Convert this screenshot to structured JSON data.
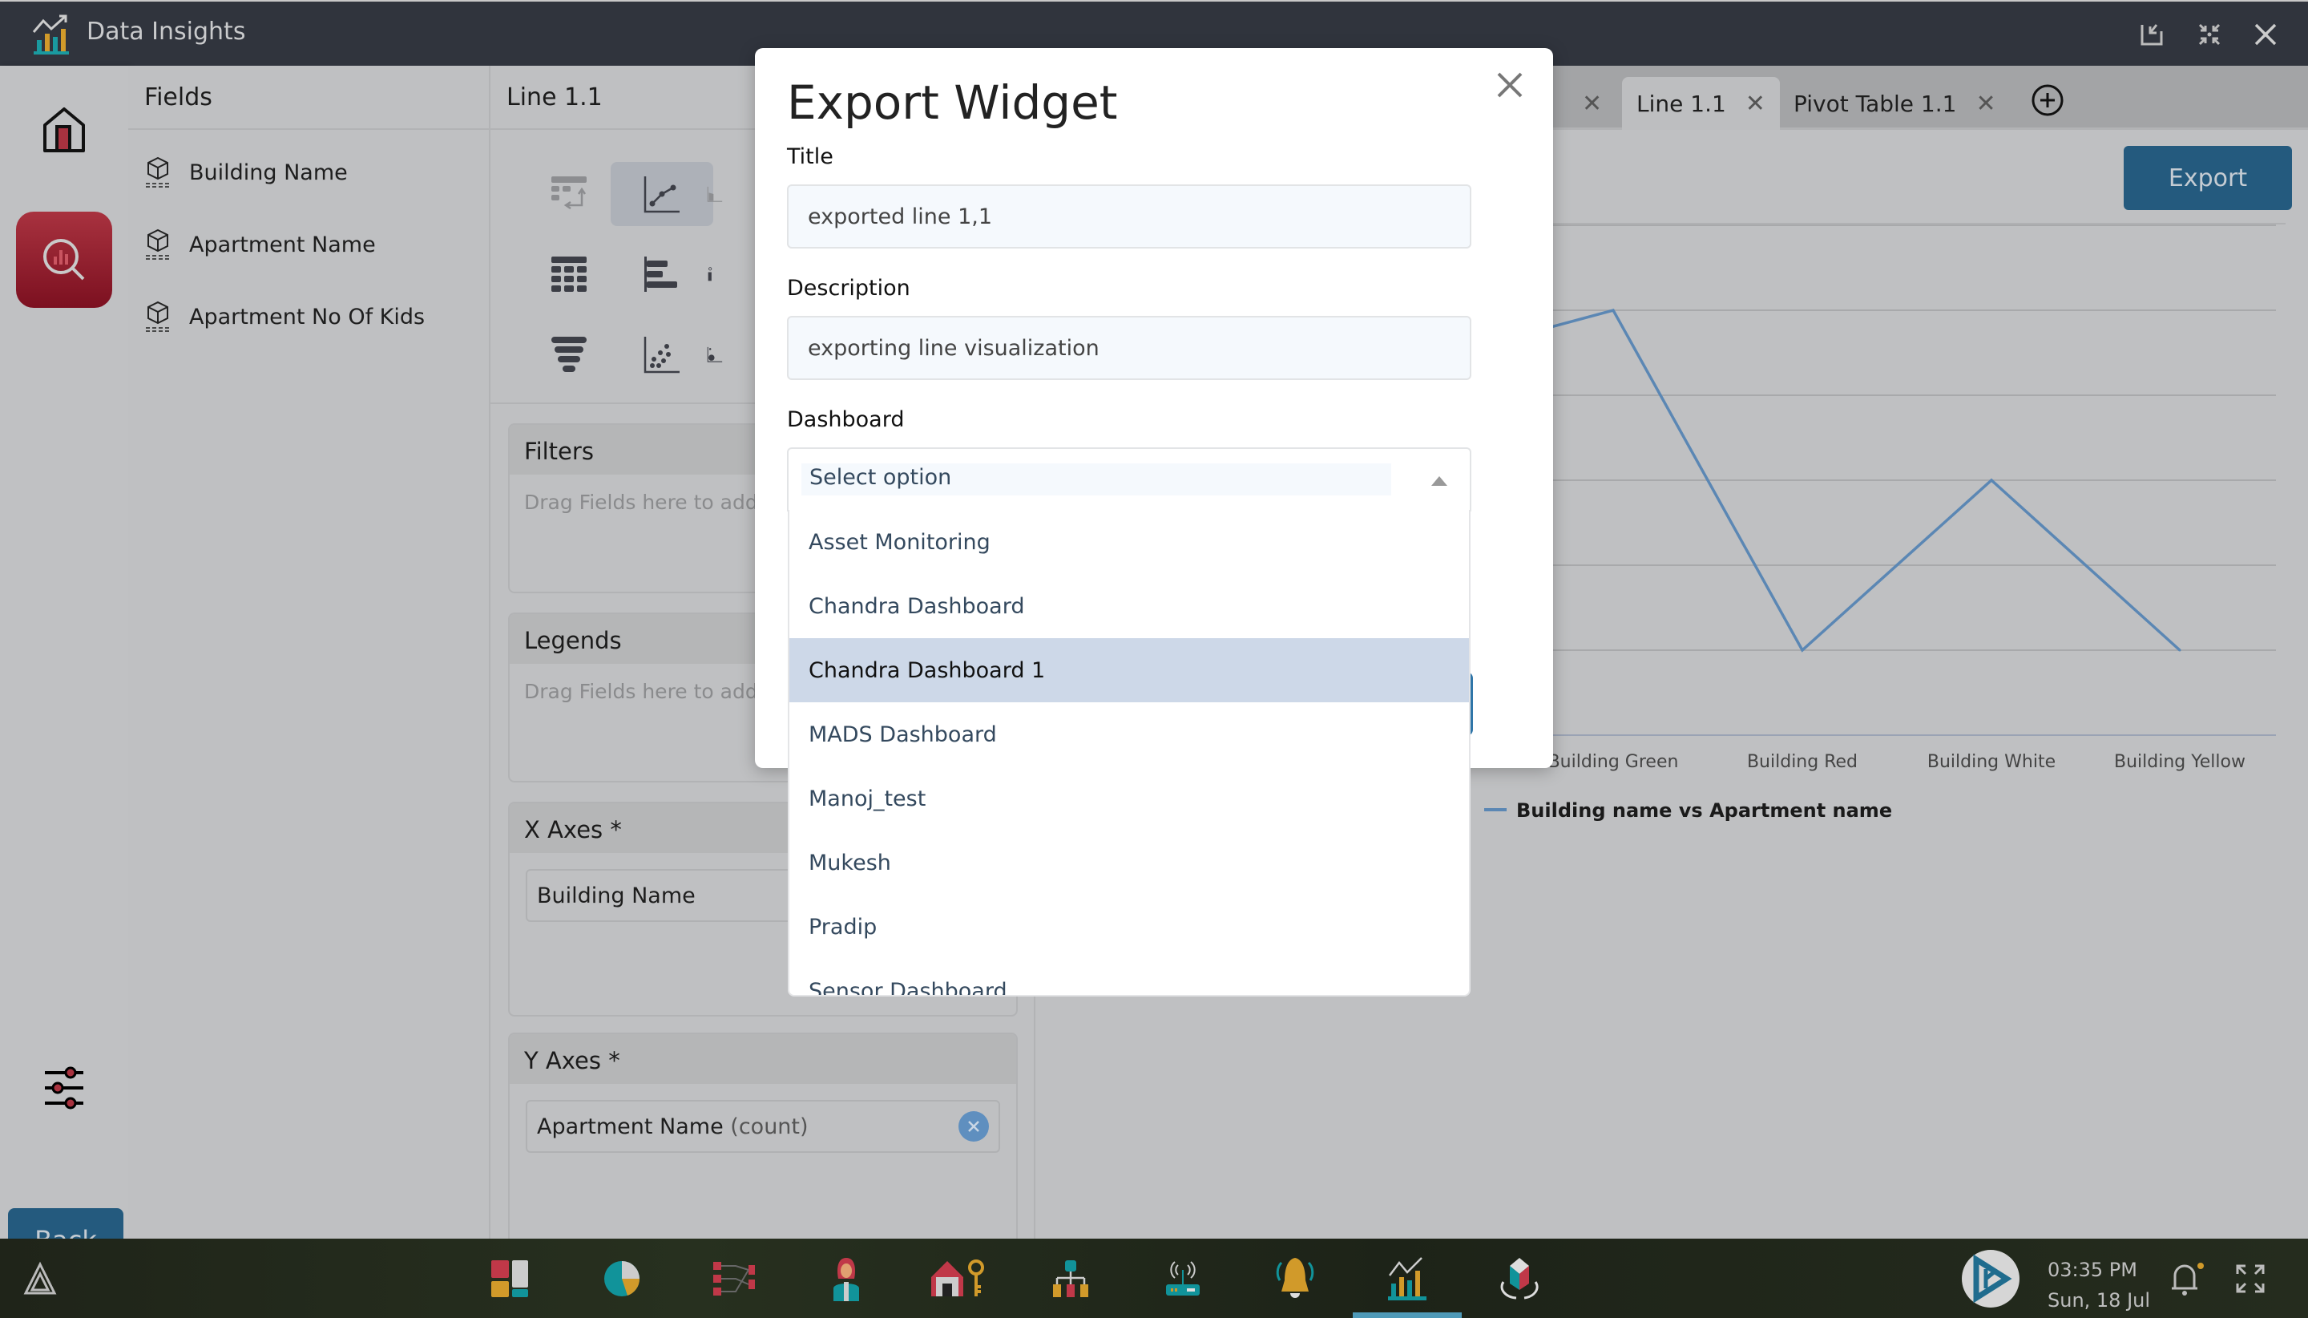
{
  "app": {
    "title": "Data Insights",
    "window_controls": [
      "restore-down-icon",
      "collapse-icon",
      "close-icon"
    ]
  },
  "rail": {
    "items": [
      {
        "name": "home",
        "icon": "home-icon"
      },
      {
        "name": "analytics",
        "icon": "analytics-search-icon",
        "active": true
      },
      {
        "name": "settings",
        "icon": "sliders-icon"
      }
    ],
    "back_label": "Back"
  },
  "fields": {
    "header": "Fields",
    "items": [
      {
        "label": "Building Name",
        "icon": "dimension-cube-icon"
      },
      {
        "label": "Apartment Name",
        "icon": "dimension-cube-icon"
      },
      {
        "label": "Apartment No Of Kids",
        "icon": "dimension-cube-icon"
      }
    ]
  },
  "config": {
    "header": "Line 1.1",
    "chart_types": [
      {
        "name": "pivot",
        "icon": "pivot-table-icon"
      },
      {
        "name": "line",
        "icon": "line-chart-icon",
        "active": true
      },
      {
        "name": "area",
        "icon": "area-chart-icon"
      },
      {
        "name": "table",
        "icon": "table-icon"
      },
      {
        "name": "horizontal-bar",
        "icon": "horizontal-bar-icon"
      },
      {
        "name": "info",
        "icon": "info-icon"
      },
      {
        "name": "funnel",
        "icon": "funnel-icon"
      },
      {
        "name": "scatter",
        "icon": "scatter-icon"
      },
      {
        "name": "bubble",
        "icon": "bubble-icon"
      }
    ],
    "filters": {
      "title": "Filters",
      "placeholder": "Drag Fields here to add F"
    },
    "legends": {
      "title": "Legends",
      "placeholder": "Drag Fields here to add L"
    },
    "x_axes": {
      "title": "X Axes *",
      "value": "Building Name"
    },
    "y_axes": {
      "title": "Y Axes *",
      "value": "Apartment Name",
      "aggregate": "(count)"
    }
  },
  "tabs": {
    "items": [
      {
        "label": "",
        "closable": true
      },
      {
        "label": "Line 1.1",
        "closable": true,
        "active": true
      },
      {
        "label": "Pivot Table 1.1",
        "closable": true
      }
    ],
    "add_icon": "plus-circle-icon"
  },
  "export_label": "Export",
  "chart_data": {
    "type": "line",
    "title": "",
    "xlabel": "",
    "ylabel": "",
    "categories": [
      "Building Green",
      "Building Red",
      "Building White",
      "Building Yellow"
    ],
    "series": [
      {
        "name": "Building name vs Apartment name",
        "values": [
          5,
          1,
          3,
          1
        ],
        "color": "#5b87b4"
      }
    ],
    "leading_partial_value": 4.4,
    "ylim": [
      0,
      6
    ],
    "grid": true,
    "legend_position": "bottom-left"
  },
  "modal": {
    "title": "Export Widget",
    "title_label": "Title",
    "title_value": "exported line 1,1",
    "description_label": "Description",
    "description_value": "exporting line visualization",
    "dashboard_label": "Dashboard",
    "dashboard_placeholder": "Select option",
    "dashboard_options": [
      "Asset Monitoring",
      "Chandra Dashboard",
      "Chandra Dashboard 1",
      "MADS Dashboard",
      "Manoj_test",
      "Mukesh",
      "Pradip",
      "Sensor Dashboard"
    ],
    "highlighted_option": "Chandra Dashboard 1"
  },
  "taskbar": {
    "apps": [
      "warning-triangle-icon",
      "dashboard-blocks-icon",
      "pie-chart-icon",
      "workflow-icon",
      "user-icon",
      "home-key-icon",
      "hierarchy-icon",
      "router-icon",
      "alarm-bell-icon",
      "data-insights-icon",
      "cube-sync-icon"
    ],
    "active_app": "data-insights-icon",
    "time": "03:35 PM",
    "date": "Sun, 18 Jul"
  },
  "colors": {
    "accent": "#245a7e",
    "brand_red": "#a8323f",
    "line": "#5b87b4",
    "highlight": "#cdd8e8"
  }
}
